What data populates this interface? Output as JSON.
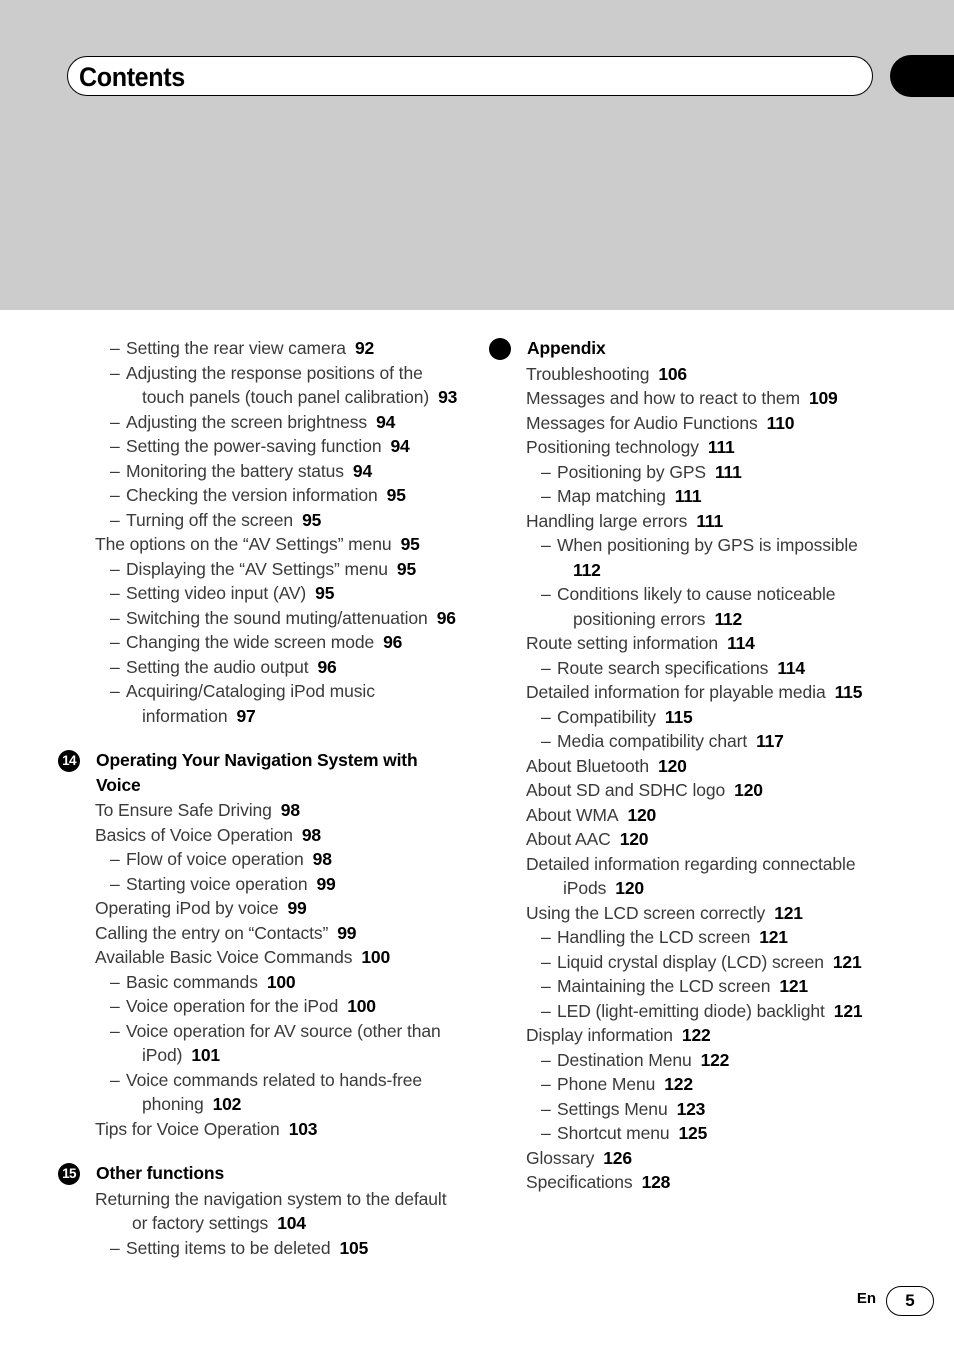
{
  "header": {
    "title": "Contents",
    "tab_icon": "black-thumb-tab"
  },
  "footer": {
    "language": "En",
    "page_number": "5"
  },
  "left_column": [
    {
      "type": "entry",
      "level": 2,
      "dash": "–",
      "text": "Setting the rear view camera",
      "page": "92"
    },
    {
      "type": "entry",
      "level": 2,
      "dash": "–",
      "text": "Adjusting the response positions of the touch panels (touch panel calibration)",
      "page": "93"
    },
    {
      "type": "entry",
      "level": 2,
      "dash": "–",
      "text": "Adjusting the screen brightness",
      "page": "94"
    },
    {
      "type": "entry",
      "level": 2,
      "dash": "–",
      "text": "Setting the power-saving function",
      "page": "94"
    },
    {
      "type": "entry",
      "level": 2,
      "dash": "–",
      "text": "Monitoring the battery status",
      "page": "94"
    },
    {
      "type": "entry",
      "level": 2,
      "dash": "–",
      "text": "Checking the version information",
      "page": "95"
    },
    {
      "type": "entry",
      "level": 2,
      "dash": "–",
      "text": "Turning off the screen",
      "page": "95"
    },
    {
      "type": "entry",
      "level": 1,
      "text": "The options on the “AV Settings” menu",
      "page": "95"
    },
    {
      "type": "entry",
      "level": 2,
      "dash": "–",
      "text": "Displaying the “AV Settings” menu",
      "page": "95"
    },
    {
      "type": "entry",
      "level": 2,
      "dash": "–",
      "text": "Setting video input (AV)",
      "page": "95"
    },
    {
      "type": "entry",
      "level": 2,
      "dash": "–",
      "text": "Switching the sound muting/attenuation",
      "page": "96"
    },
    {
      "type": "entry",
      "level": 2,
      "dash": "–",
      "text": "Changing the wide screen mode",
      "page": "96"
    },
    {
      "type": "entry",
      "level": 2,
      "dash": "–",
      "text": "Setting the audio output",
      "page": "96"
    },
    {
      "type": "entry",
      "level": 2,
      "dash": "–",
      "text": "Acquiring/Cataloging iPod music information",
      "page": "97"
    },
    {
      "type": "chapter",
      "marker": "14",
      "title": "Operating Your Navigation System with Voice"
    },
    {
      "type": "entry",
      "level": 1,
      "text": "To Ensure Safe Driving",
      "page": "98"
    },
    {
      "type": "entry",
      "level": 1,
      "text": "Basics of Voice Operation",
      "page": "98"
    },
    {
      "type": "entry",
      "level": 2,
      "dash": "–",
      "text": "Flow of voice operation",
      "page": "98"
    },
    {
      "type": "entry",
      "level": 2,
      "dash": "–",
      "text": "Starting voice operation",
      "page": "99"
    },
    {
      "type": "entry",
      "level": 1,
      "text": "Operating iPod by voice",
      "page": "99"
    },
    {
      "type": "entry",
      "level": 1,
      "text": "Calling the entry on “Contacts”",
      "page": "99"
    },
    {
      "type": "entry",
      "level": 1,
      "text": "Available Basic Voice Commands",
      "page": "100"
    },
    {
      "type": "entry",
      "level": 2,
      "dash": "–",
      "text": "Basic commands",
      "page": "100"
    },
    {
      "type": "entry",
      "level": 2,
      "dash": "–",
      "text": "Voice operation for the iPod",
      "page": "100"
    },
    {
      "type": "entry",
      "level": 2,
      "dash": "–",
      "text": "Voice operation for AV source (other than iPod)",
      "page": "101"
    },
    {
      "type": "entry",
      "level": 2,
      "dash": "–",
      "text": "Voice commands related to hands-free phoning",
      "page": "102"
    },
    {
      "type": "entry",
      "level": 1,
      "text": "Tips for Voice Operation",
      "page": "103"
    },
    {
      "type": "chapter",
      "marker": "15",
      "title": "Other functions"
    },
    {
      "type": "entry",
      "level": 1,
      "text": "Returning the navigation system to the default or factory settings",
      "page": "104"
    },
    {
      "type": "entry",
      "level": 2,
      "dash": "–",
      "text": "Setting items to be deleted",
      "page": "105"
    }
  ],
  "right_column": [
    {
      "type": "chapter",
      "marker": "",
      "marker_style": "filled-circle",
      "title": "Appendix"
    },
    {
      "type": "entry",
      "level": 1,
      "text": "Troubleshooting",
      "page": "106"
    },
    {
      "type": "entry",
      "level": 1,
      "text": "Messages and how to react to them",
      "page": "109"
    },
    {
      "type": "entry",
      "level": 1,
      "text": "Messages for Audio Functions",
      "page": "110"
    },
    {
      "type": "entry",
      "level": 1,
      "text": "Positioning technology",
      "page": "111"
    },
    {
      "type": "entry",
      "level": 2,
      "dash": "–",
      "text": "Positioning by GPS",
      "page": "111"
    },
    {
      "type": "entry",
      "level": 2,
      "dash": "–",
      "text": "Map matching",
      "page": "111"
    },
    {
      "type": "entry",
      "level": 1,
      "text": "Handling large errors",
      "page": "111"
    },
    {
      "type": "entry",
      "level": 2,
      "dash": "–",
      "text": "When positioning by GPS is impossible",
      "page": "112"
    },
    {
      "type": "entry",
      "level": 2,
      "dash": "–",
      "text": "Conditions likely to cause noticeable positioning errors",
      "page": "112"
    },
    {
      "type": "entry",
      "level": 1,
      "text": "Route setting information",
      "page": "114"
    },
    {
      "type": "entry",
      "level": 2,
      "dash": "–",
      "text": "Route search specifications",
      "page": "114"
    },
    {
      "type": "entry",
      "level": 1,
      "text": "Detailed information for playable media",
      "page": "115"
    },
    {
      "type": "entry",
      "level": 2,
      "dash": "–",
      "text": "Compatibility",
      "page": "115"
    },
    {
      "type": "entry",
      "level": 2,
      "dash": "–",
      "text": "Media compatibility chart",
      "page": "117"
    },
    {
      "type": "entry",
      "level": 1,
      "text": "About Bluetooth",
      "page": "120"
    },
    {
      "type": "entry",
      "level": 1,
      "text": "About SD and SDHC logo",
      "page": "120"
    },
    {
      "type": "entry",
      "level": 1,
      "text": "About WMA",
      "page": "120"
    },
    {
      "type": "entry",
      "level": 1,
      "text": "About AAC",
      "page": "120"
    },
    {
      "type": "entry",
      "level": 1,
      "text": "Detailed information regarding connectable iPods",
      "page": "120"
    },
    {
      "type": "entry",
      "level": 1,
      "text": "Using the LCD screen correctly",
      "page": "121"
    },
    {
      "type": "entry",
      "level": 2,
      "dash": "–",
      "text": "Handling the LCD screen",
      "page": "121"
    },
    {
      "type": "entry",
      "level": 2,
      "dash": "–",
      "text": "Liquid crystal display (LCD) screen",
      "page": "121"
    },
    {
      "type": "entry",
      "level": 2,
      "dash": "–",
      "text": "Maintaining the LCD screen",
      "page": "121"
    },
    {
      "type": "entry",
      "level": 2,
      "dash": "–",
      "text": "LED (light-emitting diode) backlight",
      "page": "121"
    },
    {
      "type": "entry",
      "level": 1,
      "text": "Display information",
      "page": "122"
    },
    {
      "type": "entry",
      "level": 2,
      "dash": "–",
      "text": "Destination Menu",
      "page": "122"
    },
    {
      "type": "entry",
      "level": 2,
      "dash": "–",
      "text": "Phone Menu",
      "page": "122"
    },
    {
      "type": "entry",
      "level": 2,
      "dash": "–",
      "text": "Settings Menu",
      "page": "123"
    },
    {
      "type": "entry",
      "level": 2,
      "dash": "–",
      "text": "Shortcut menu",
      "page": "125"
    },
    {
      "type": "entry",
      "level": 1,
      "text": "Glossary",
      "page": "126"
    },
    {
      "type": "entry",
      "level": 1,
      "text": "Specifications",
      "page": "128"
    }
  ]
}
